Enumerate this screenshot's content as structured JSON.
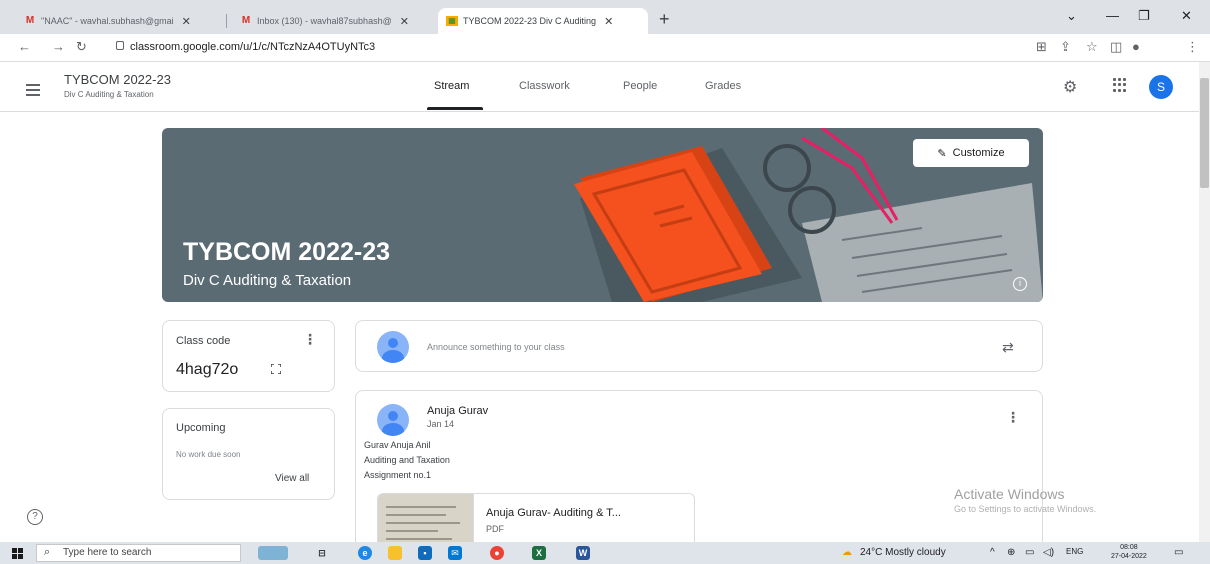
{
  "browser": {
    "tabs": [
      {
        "label": "\"NAAC\" - wavhal.subhash@gmai",
        "icon": "gmail-icon"
      },
      {
        "label": "Inbox (130) - wavhal87subhash@",
        "icon": "gmail-icon"
      },
      {
        "label": "TYBCOM 2022-23 Div C Auditing",
        "icon": "classroom-icon"
      }
    ],
    "url": "classroom.google.com/u/1/c/NTczNzA4OTUyNTc3"
  },
  "header": {
    "class_name": "TYBCOM 2022-23",
    "section": "Div C Auditing & Taxation",
    "tabs": [
      "Stream",
      "Classwork",
      "People",
      "Grades"
    ],
    "active_tab": "Stream",
    "avatar_letter": "S"
  },
  "banner": {
    "title": "TYBCOM 2022-23",
    "subtitle": "Div C Auditing & Taxation",
    "customize_label": "Customize",
    "color": "#5b6b74"
  },
  "class_code": {
    "label": "Class code",
    "value": "4hag72o"
  },
  "upcoming": {
    "title": "Upcoming",
    "text": "No work due soon",
    "link": "View all"
  },
  "announce": {
    "placeholder": "Announce something to your class"
  },
  "post": {
    "author": "Anuja Gurav",
    "date": "Jan 14",
    "lines": [
      "Gurav Anuja Anil",
      "Auditing and Taxation",
      "Assignment no.1"
    ],
    "attachment": {
      "title": "Anuja Gurav- Auditing & T...",
      "type": "PDF"
    }
  },
  "watermark": {
    "title": "Activate Windows",
    "text": "Go to Settings to activate Windows."
  },
  "taskbar": {
    "search_placeholder": "Type here to search",
    "weather": "24°C  Mostly cloudy",
    "lang": "ENG",
    "time": "08:08",
    "date": "27-04-2022"
  },
  "colors": {
    "accent": "#1a73e8",
    "banner_book": "#f4511e",
    "glasses": "#e91e63"
  }
}
